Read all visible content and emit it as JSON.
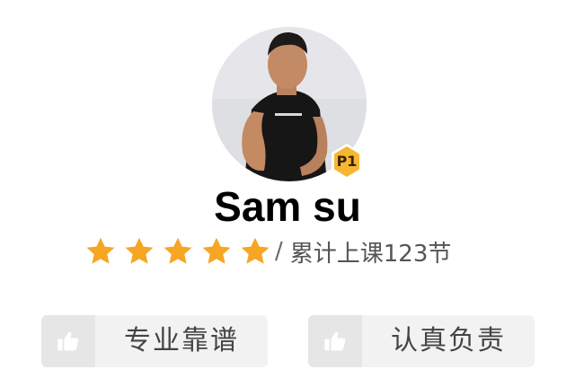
{
  "profile": {
    "name": "Sam su",
    "level_badge": "P1",
    "rating_stars": 5,
    "rating_max": 5,
    "separator": "/",
    "lesson_count_text": "累计上课123节"
  },
  "tags": [
    {
      "label": "专业靠谱",
      "icon": "thumbs-up-icon"
    },
    {
      "label": "认真负责",
      "icon": "thumbs-up-icon"
    }
  ],
  "colors": {
    "star": "#f6a623",
    "badge": "#f5b731",
    "tag_bg": "#f2f2f2",
    "tag_icon_bg": "#e6e6e6",
    "text_primary": "#000000",
    "text_secondary": "#555555"
  }
}
